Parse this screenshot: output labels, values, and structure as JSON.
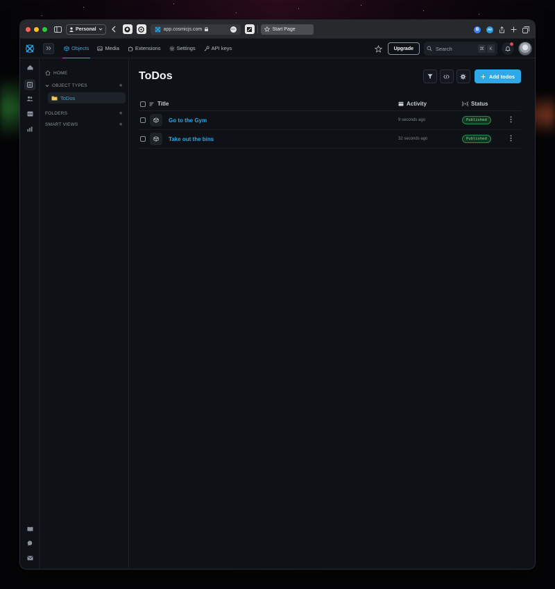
{
  "browser": {
    "profile_label": "Personal",
    "url": "app.cosmicjs.com",
    "tab_label": "Start Page",
    "extensions": [
      {
        "label": "B",
        "color": "#3b82f6"
      },
      {
        "label": "AV",
        "color": "#2e9be0"
      }
    ]
  },
  "topbar": {
    "nav": [
      {
        "label": "Objects",
        "icon": "cube-icon",
        "active": true
      },
      {
        "label": "Media",
        "icon": "image-icon",
        "active": false
      },
      {
        "label": "Extensions",
        "icon": "puzzle-icon",
        "active": false
      },
      {
        "label": "Settings",
        "icon": "gear-icon",
        "active": false
      },
      {
        "label": "API keys",
        "icon": "key-icon",
        "active": false
      }
    ],
    "upgrade_label": "Upgrade",
    "search_placeholder": "Search",
    "search_kbd_1": "⌘",
    "search_kbd_2": "K"
  },
  "sidebar": {
    "home_label": "HOME",
    "object_types_label": "OBJECT TYPES",
    "object_types": [
      {
        "label": "ToDos"
      }
    ],
    "folders_label": "FOLDERS",
    "smart_views_label": "SMART VIEWS"
  },
  "main": {
    "title": "ToDos",
    "add_label": "Add todos",
    "columns": {
      "title": "Title",
      "activity": "Activity",
      "status": "Status"
    },
    "rows": [
      {
        "title": "Go to the Gym",
        "activity": "9 seconds ago",
        "status": "Published"
      },
      {
        "title": "Take out the bins",
        "activity": "32 seconds ago",
        "status": "Published"
      }
    ]
  },
  "colors": {
    "accent": "#2ea8e6",
    "published_bg": "#143522",
    "published_text": "#7fd99a",
    "notification": "#e5484d"
  }
}
